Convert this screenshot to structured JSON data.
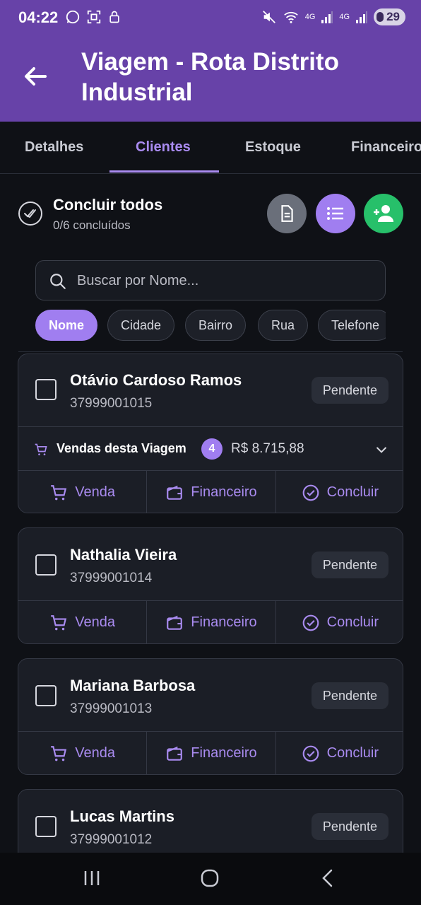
{
  "status": {
    "time": "04:22",
    "net1": "4G",
    "net2": "4G",
    "battery": "29"
  },
  "header": {
    "title": "Viagem - Rota Distrito Industrial"
  },
  "tabs": [
    {
      "label": "Detalhes"
    },
    {
      "label": "Clientes",
      "active": true
    },
    {
      "label": "Estoque"
    },
    {
      "label": "Financeiro"
    }
  ],
  "conclude": {
    "title": "Concluir todos",
    "subtitle": "0/6 concluídos"
  },
  "search": {
    "placeholder": "Buscar por Nome..."
  },
  "filters": [
    {
      "label": "Nome",
      "active": true
    },
    {
      "label": "Cidade"
    },
    {
      "label": "Bairro"
    },
    {
      "label": "Rua"
    },
    {
      "label": "Telefone"
    }
  ],
  "clients": [
    {
      "name": "Otávio Cardoso Ramos",
      "phone": "37999001015",
      "status": "Pendente",
      "sales": {
        "label": "Vendas desta Viagem",
        "count": "4",
        "total": "R$ 8.715,88"
      }
    },
    {
      "name": "Nathalia Vieira",
      "phone": "37999001014",
      "status": "Pendente"
    },
    {
      "name": "Mariana Barbosa",
      "phone": "37999001013",
      "status": "Pendente"
    },
    {
      "name": "Lucas Martins",
      "phone": "37999001012",
      "status": "Pendente"
    }
  ],
  "actions": {
    "sale": "Venda",
    "finance": "Financeiro",
    "conclude": "Concluir"
  },
  "colors": {
    "primary": "#6742a8",
    "accent": "#a07ef0",
    "success": "#27c06a",
    "background": "#0f1116"
  },
  "icons": [
    "back-arrow-icon",
    "double-check-icon",
    "document-icon",
    "list-icon",
    "add-user-icon",
    "search-icon",
    "cart-icon",
    "wallet-icon",
    "check-circle-icon",
    "chevron-down-icon"
  ]
}
